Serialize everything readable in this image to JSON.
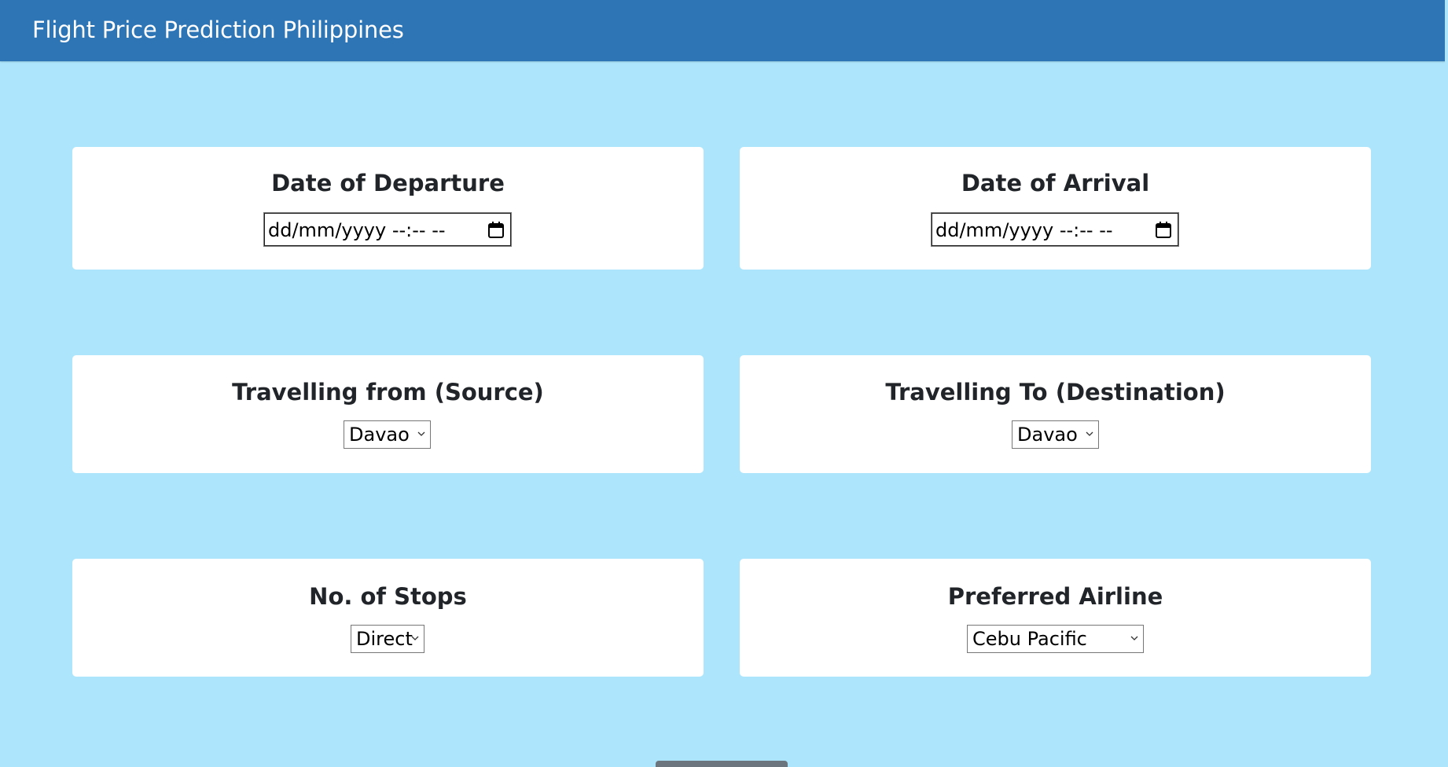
{
  "navbar": {
    "brand": "Flight Price Prediction Philippines"
  },
  "colors": {
    "navbar_bg": "#2e75b6",
    "page_bg": "#ade6fc",
    "card_bg": "#ffffff"
  },
  "departure": {
    "title": "Date of Departure",
    "placeholder": "dd/mm/yyyy --:-- --",
    "icon": "calendar-icon"
  },
  "arrival": {
    "title": "Date of Arrival",
    "placeholder": "dd/mm/yyyy --:-- --",
    "icon": "calendar-icon"
  },
  "source": {
    "title": "Travelling from (Source)",
    "selected": "Davao"
  },
  "destination": {
    "title": "Travelling To (Destination)",
    "selected": "Davao"
  },
  "stops": {
    "title": "No. of Stops",
    "selected": "Direct"
  },
  "airline": {
    "title": "Preferred Airline",
    "selected": "Cebu Pacific"
  }
}
